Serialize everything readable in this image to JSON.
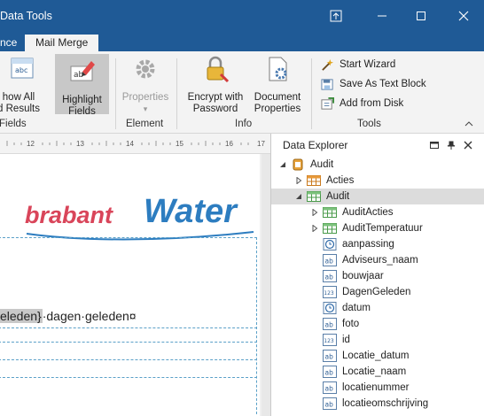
{
  "titlebar": {
    "title": "Data Tools",
    "bg": "#1f5a96"
  },
  "tabs": [
    {
      "label": "nce"
    },
    {
      "label": "Mail Merge"
    }
  ],
  "ribbon": {
    "show_all": {
      "line1": "how All",
      "line2": "d Results"
    },
    "highlight": {
      "line1": "Highlight",
      "line2": "Fields"
    },
    "properties": {
      "line1": "Properties",
      "arrow": "▾"
    },
    "encrypt": {
      "line1": "Encrypt with",
      "line2": "Password"
    },
    "docprops": {
      "line1": "Document",
      "line2": "Properties"
    },
    "start_wizard": "Start Wizard",
    "save_text_block": "Save As Text Block",
    "add_from_disk": "Add from Disk",
    "groups": {
      "fields": "Fields",
      "element": "Element",
      "info": "Info",
      "tools": "Tools"
    }
  },
  "ruler": {
    "ticks": [
      "12",
      "13",
      "14",
      "15",
      "16",
      "17"
    ]
  },
  "document": {
    "logo_left": "brabant",
    "logo_right": "Water",
    "field": "eleden}",
    "text": "·dagen·geleden¤"
  },
  "explorer": {
    "title": "Data Explorer",
    "nodes": [
      {
        "label": "Audit",
        "icon": "database-icon",
        "level": 0,
        "expander": "open"
      },
      {
        "label": "Acties",
        "icon": "table-orange-icon",
        "level": 1,
        "expander": "closed"
      },
      {
        "label": "Audit",
        "icon": "table-green-icon",
        "level": 1,
        "expander": "open",
        "selected": true
      },
      {
        "label": "AuditActies",
        "icon": "table-green-icon",
        "level": 2,
        "expander": "closed"
      },
      {
        "label": "AuditTemperatuur",
        "icon": "table-green-icon",
        "level": 2,
        "expander": "closed"
      },
      {
        "label": "aanpassing",
        "icon": "clock-icon",
        "level": 2
      },
      {
        "label": "Adviseurs_naam",
        "icon": "text-field-icon",
        "level": 2
      },
      {
        "label": "bouwjaar",
        "icon": "text-field-icon",
        "level": 2
      },
      {
        "label": "DagenGeleden",
        "icon": "number-field-icon",
        "level": 2
      },
      {
        "label": "datum",
        "icon": "clock-icon",
        "level": 2
      },
      {
        "label": "foto",
        "icon": "text-field-icon",
        "level": 2
      },
      {
        "label": "id",
        "icon": "number-field-icon",
        "level": 2
      },
      {
        "label": "Locatie_datum",
        "icon": "text-field-icon",
        "level": 2
      },
      {
        "label": "Locatie_naam",
        "icon": "text-field-icon",
        "level": 2
      },
      {
        "label": "locatienummer",
        "icon": "text-field-icon",
        "level": 2
      },
      {
        "label": "locatieomschrijving",
        "icon": "text-field-icon",
        "level": 2
      }
    ]
  }
}
